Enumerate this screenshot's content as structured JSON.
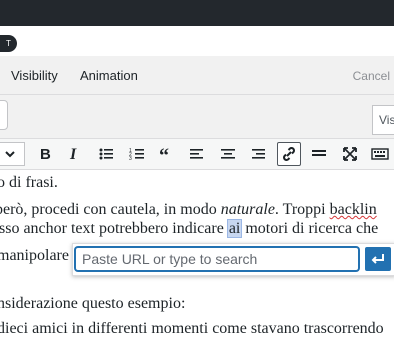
{
  "top_pill": {
    "label": "T"
  },
  "tabs": [
    {
      "label": "Visibility"
    },
    {
      "label": "Animation"
    }
  ],
  "cancel_label": "Cancel",
  "visibility_field": {
    "label": "Vis"
  },
  "toolbar": {
    "icons": [
      "chevron-down-icon",
      "bold-icon",
      "italic-icon",
      "bullet-list-icon",
      "numbered-list-icon",
      "blockquote-icon",
      "align-left-icon",
      "align-center-icon",
      "align-right-icon",
      "link-icon",
      "horizontal-rule-icon",
      "fullscreen-icon",
      "keyboard-icon"
    ],
    "active": "link-icon"
  },
  "content": {
    "line1": "o di frasi.",
    "line2_a": "però, procedi con cautela, in modo ",
    "line2_italic": "naturale",
    "line2_b": ". Troppi ",
    "line2_err": "backlin",
    "line3_a": "sso anchor text potrebbero indicare ",
    "line3_hl": "ai",
    "line3_b": " motori di ricerca che",
    "line4": "manipolare",
    "line5": "nsiderazione questo esempio:",
    "line6": "dieci amici in differenti momenti come stavano trascorrendo"
  },
  "link_popup": {
    "placeholder": "Paste URL or type to search",
    "value": ""
  },
  "colors": {
    "dark_bar": "#23282d",
    "panel_bg": "#f1f1f1",
    "accent": "#2271b1"
  }
}
